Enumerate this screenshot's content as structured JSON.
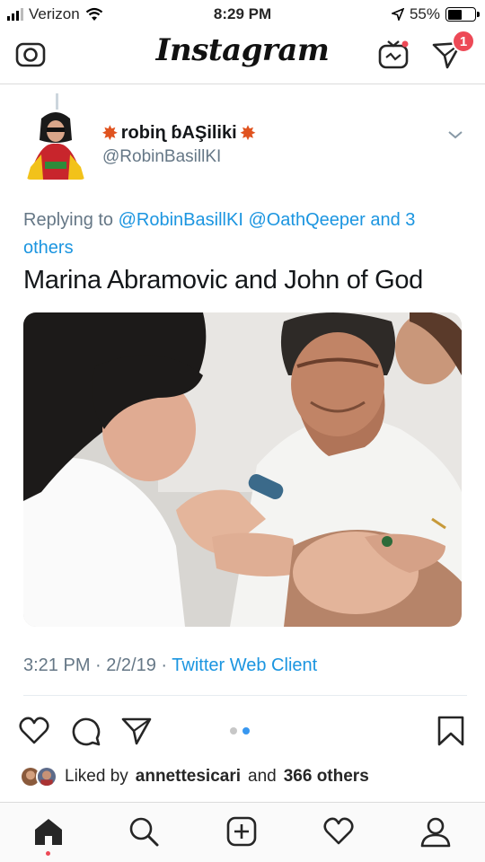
{
  "status_bar": {
    "carrier": "Verizon",
    "time": "8:29 PM",
    "battery": "55%",
    "battery_level": 0.55,
    "icons": [
      "signal-icon",
      "wifi-icon",
      "location-arrow-icon",
      "battery-icon"
    ]
  },
  "header": {
    "title": "Instagram",
    "direct_badge": "1",
    "icons": [
      "camera-icon",
      "igtv-icon",
      "direct-message-icon"
    ]
  },
  "tweet": {
    "display_name": "robiɳ ɓAŞiliki",
    "handle": "@RobinBasillKI",
    "replying_prefix": "Replying to",
    "replying_to_1": "@RobinBasillKI",
    "replying_to_2": "@OathQeeper",
    "replying_rest": "and 3 others",
    "text": "Marina Abramovic and John of God",
    "time": "3:21 PM · 2/2/19 · ",
    "source": "Twitter Web Client",
    "colors": {
      "link": "#1b95e0",
      "muted": "#657786"
    }
  },
  "actions": {
    "icons": [
      "heart-icon",
      "comment-icon",
      "share-icon",
      "bookmark-icon"
    ],
    "carousel_count": 2,
    "carousel_active": 2
  },
  "likes": {
    "prefix": "Liked by",
    "user": "annettesicari",
    "middle": "and",
    "others": "366 others"
  },
  "tabbar": {
    "icons": [
      "home-icon",
      "search-icon",
      "add-post-icon",
      "activity-heart-icon",
      "profile-icon"
    ]
  }
}
